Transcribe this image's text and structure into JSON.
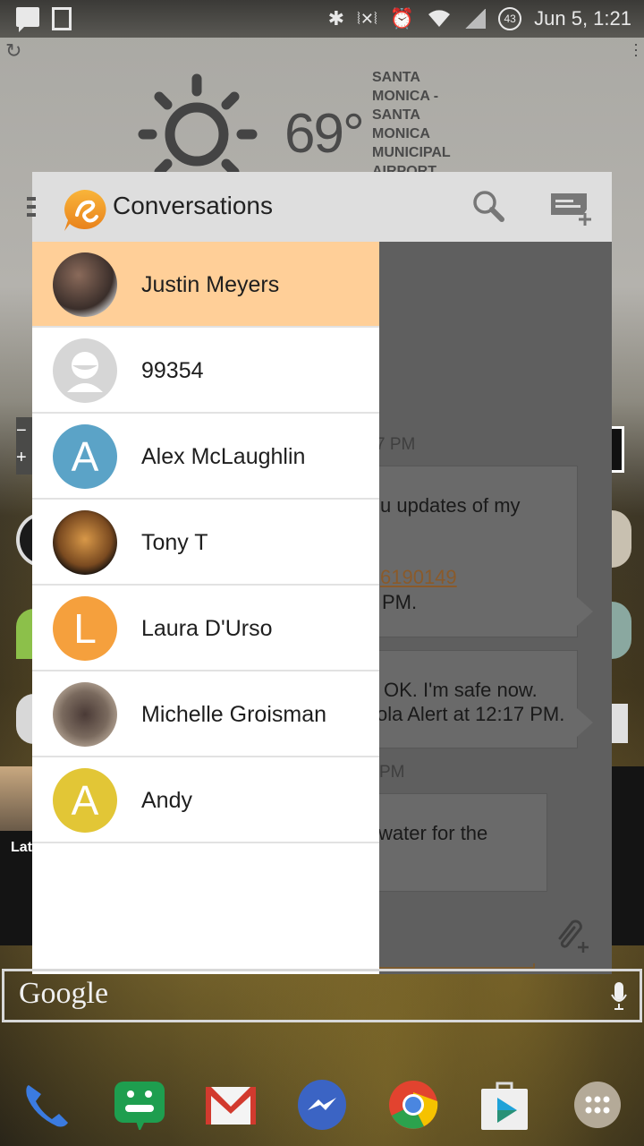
{
  "status_bar": {
    "notifications": [
      "message-notification-icon",
      "image-notification-icon"
    ],
    "system_icons": [
      "bluetooth-icon",
      "vibrate-icon",
      "alarm-icon",
      "wifi-icon",
      "cell-signal-icon"
    ],
    "battery_level": "43",
    "clock": "Jun 5, 1:21"
  },
  "weather_widget": {
    "condition_icon": "sun-icon",
    "temperature": "69°",
    "location_lines": [
      "SANTA",
      "MONICA -",
      "SANTA",
      "MONICA",
      "MUNICIPAL",
      "AIRPORT"
    ]
  },
  "app": {
    "title": "Conversations",
    "logo": "app-logo-icon",
    "actions": {
      "search": "search-icon",
      "new_conversation": "new-message-icon"
    },
    "conversations": [
      {
        "name": "Justin Meyers",
        "avatar_type": "photo",
        "selected": true
      },
      {
        "name": "99354",
        "avatar_type": "placeholder",
        "selected": false
      },
      {
        "name": "Alex McLaughlin",
        "avatar_type": "letter",
        "letter": "A",
        "color": "#5ba3c7",
        "selected": false
      },
      {
        "name": "Tony T",
        "avatar_type": "photo",
        "selected": false
      },
      {
        "name": "Laura D'Urso",
        "avatar_type": "letter",
        "letter": "L",
        "color": "#f5a03d",
        "selected": false
      },
      {
        "name": "Michelle Groisman",
        "avatar_type": "photo",
        "selected": false
      },
      {
        "name": "Andy",
        "avatar_type": "letter",
        "letter": "A",
        "color": "#e2c636",
        "selected": false
      }
    ],
    "chat_preview": {
      "timestamp_1": "7 PM",
      "message_1_line_1": "u updates of my",
      "message_1_link": "6190149",
      "message_1_line_3": "PM.",
      "message_2_line_1": "OK. I'm safe now.",
      "message_2_line_2": "ola Alert at 12:17 PM.",
      "timestamp_2": "PM",
      "message_3_line_1": "water for the"
    }
  },
  "colors": {
    "selected_row": "#ffcf98",
    "app_bar": "#dedede",
    "accent": "#f5a03d"
  },
  "home_screen": {
    "search_label": "Google",
    "latest_label": "Lat",
    "dock_apps": [
      "phone",
      "hangouts",
      "gmail",
      "messenger",
      "chrome",
      "play-store",
      "app-drawer"
    ]
  }
}
